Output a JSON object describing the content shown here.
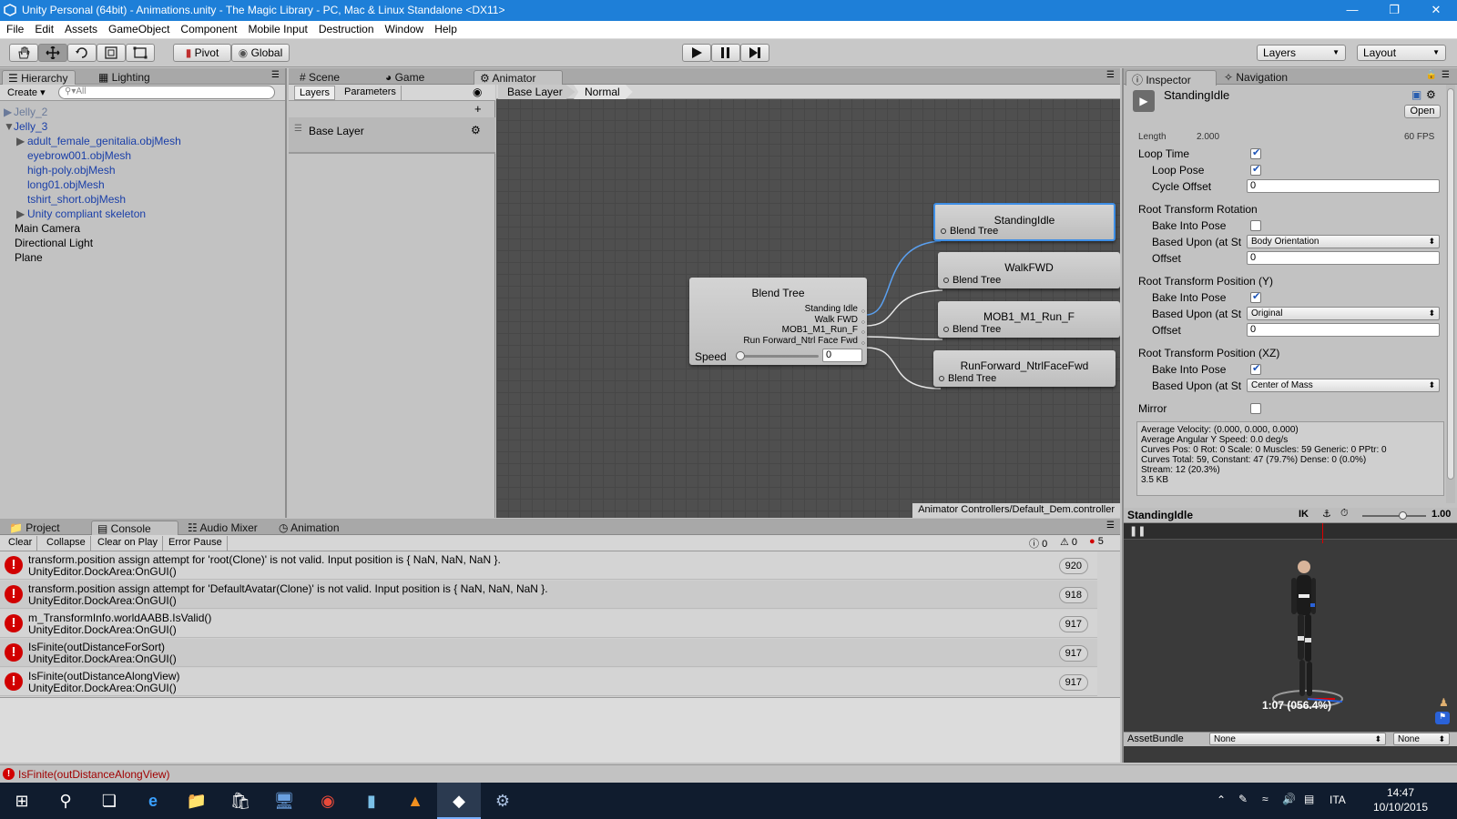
{
  "window": {
    "title": "Unity Personal (64bit) - Animations.unity - The Magic Library - PC, Mac & Linux Standalone <DX11>"
  },
  "menu": [
    "File",
    "Edit",
    "Assets",
    "GameObject",
    "Component",
    "Mobile Input",
    "Destruction",
    "Window",
    "Help"
  ],
  "toolbar": {
    "pivot": "Pivot",
    "global": "Global",
    "layers": "Layers",
    "layout": "Layout"
  },
  "hierarchy": {
    "tabs": [
      "Hierarchy",
      "Lighting"
    ],
    "create": "Create",
    "search_placeholder": "All",
    "items": [
      "Jelly_2",
      "Jelly_3",
      "adult_female_genitalia.objMesh",
      "eyebrow001.objMesh",
      "high-poly.objMesh",
      "long01.objMesh",
      "tshirt_short.objMesh",
      "Unity compliant skeleton",
      "Main Camera",
      "Directional Light",
      "Plane"
    ]
  },
  "center_tabs": [
    "Scene",
    "Game",
    "Animator"
  ],
  "animator": {
    "subtabs": [
      "Layers",
      "Parameters"
    ],
    "layer_name": "Base Layer",
    "breadcrumb": [
      "Base Layer",
      "Normal"
    ],
    "blend_tree": {
      "title": "Blend Tree",
      "outputs": [
        "Standing Idle",
        "Walk FWD",
        "MOB1_M1_Run_F",
        "Run Forward_Ntrl Face Fwd"
      ],
      "param_label": "Speed",
      "param_value": "0",
      "slider_value": 0
    },
    "states": [
      {
        "name": "StandingIdle",
        "sub": "Blend Tree"
      },
      {
        "name": "WalkFWD",
        "sub": "Blend Tree"
      },
      {
        "name": "MOB1_M1_Run_F",
        "sub": "Blend Tree"
      },
      {
        "name": "RunForward_NtrlFaceFwd",
        "sub": "Blend Tree"
      }
    ],
    "footer_path": "Animator Controllers/Default_Dem.controller"
  },
  "inspector": {
    "tabs": [
      "Inspector",
      "Navigation"
    ],
    "clip_name": "StandingIdle",
    "open_button": "Open",
    "length_label": "Length",
    "length_value": "2.000",
    "fps": "60 FPS",
    "loop_time": {
      "label": "Loop Time",
      "checked": true
    },
    "loop_pose": {
      "label": "Loop Pose",
      "checked": true
    },
    "cycle_offset": {
      "label": "Cycle Offset",
      "value": "0"
    },
    "rot_header": "Root Transform Rotation",
    "rot_bake": {
      "label": "Bake Into Pose",
      "checked": false
    },
    "rot_based": {
      "label": "Based Upon (at St",
      "value": "Body Orientation"
    },
    "rot_offset": {
      "label": "Offset",
      "value": "0"
    },
    "posy_header": "Root Transform Position (Y)",
    "posy_bake": {
      "label": "Bake Into Pose",
      "checked": true
    },
    "posy_based": {
      "label": "Based Upon (at St",
      "value": "Original"
    },
    "posy_offset": {
      "label": "Offset",
      "value": "0"
    },
    "posxz_header": "Root Transform Position (XZ)",
    "posxz_bake": {
      "label": "Bake Into Pose",
      "checked": true
    },
    "posxz_based": {
      "label": "Based Upon (at St",
      "value": "Center of Mass"
    },
    "mirror": {
      "label": "Mirror",
      "checked": false
    },
    "info": [
      "Average Velocity: (0.000, 0.000, 0.000)",
      "Average Angular Y Speed: 0.0 deg/s",
      "Curves Pos: 0 Rot: 0 Scale: 0 Muscles: 59 Generic: 0 PPtr: 0",
      "Curves Total: 59, Constant: 47 (79.7%) Dense: 0 (0.0%)",
      "Stream: 12 (20.3%)",
      "3.5 KB"
    ],
    "preview": {
      "name": "StandingIdle",
      "ik": "IK",
      "speed": "1.00",
      "time": "1:07 (056.4%)"
    },
    "assetbundle": {
      "label": "AssetBundle",
      "value1": "None",
      "value2": "None"
    }
  },
  "bottom": {
    "tabs": [
      "Project",
      "Console",
      "Audio Mixer",
      "Animation"
    ],
    "buttons": [
      "Clear",
      "Collapse",
      "Clear on Play",
      "Error Pause"
    ],
    "counts": {
      "info": "0",
      "warn": "0",
      "error": "5"
    },
    "entries": [
      {
        "line1": "transform.position assign attempt for 'root(Clone)' is not valid. Input position is { NaN, NaN, NaN }.",
        "line2": "UnityEditor.DockArea:OnGUI()",
        "count": "920"
      },
      {
        "line1": "transform.position assign attempt for 'DefaultAvatar(Clone)' is not valid. Input position is { NaN, NaN, NaN }.",
        "line2": "UnityEditor.DockArea:OnGUI()",
        "count": "918"
      },
      {
        "line1": "m_TransformInfo.worldAABB.IsValid()",
        "line2": "UnityEditor.DockArea:OnGUI()",
        "count": "917"
      },
      {
        "line1": "IsFinite(outDistanceForSort)",
        "line2": "UnityEditor.DockArea:OnGUI()",
        "count": "917"
      },
      {
        "line1": "IsFinite(outDistanceAlongView)",
        "line2": "UnityEditor.DockArea:OnGUI()",
        "count": "917"
      }
    ]
  },
  "status_bar": "IsFinite(outDistanceAlongView)",
  "taskbar": {
    "lang": "ITA",
    "time": "14:47",
    "date": "10/10/2015"
  },
  "colors": {
    "titlebar": "#1e7fd8",
    "grid": "#4f4f4f",
    "selected_node": "#3d8ee6",
    "error": "#d10000"
  }
}
